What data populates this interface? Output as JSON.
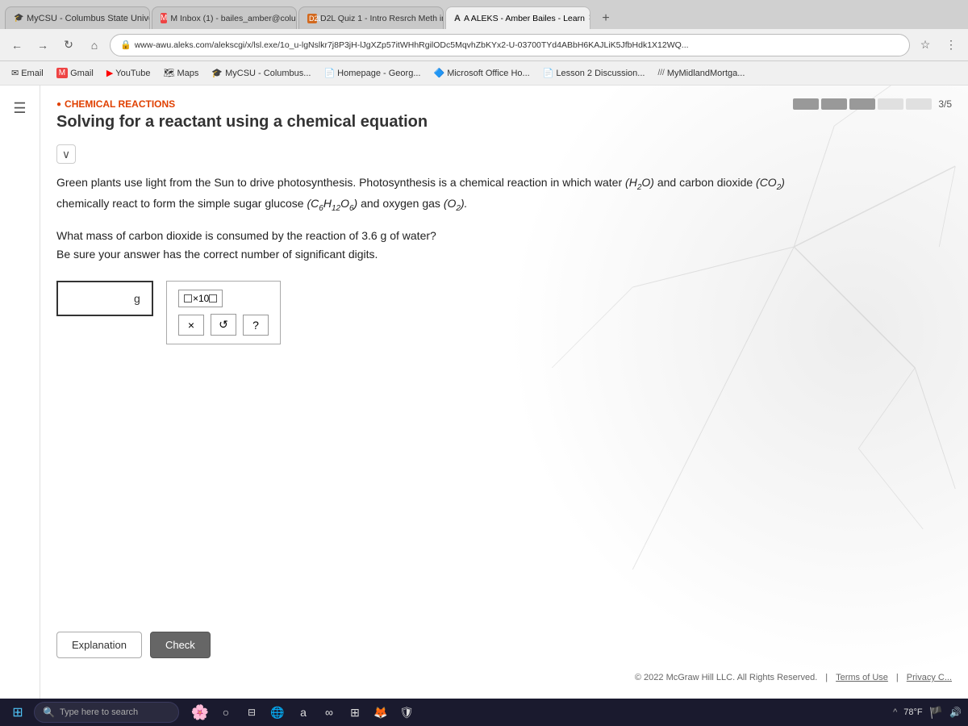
{
  "browser": {
    "tabs": [
      {
        "id": "tab1",
        "label": "MyCSU - Columbus State Univers",
        "active": false,
        "favicon": "🎓"
      },
      {
        "id": "tab2",
        "label": "M Inbox (1) - bailes_amber@colum",
        "active": false,
        "favicon": "M"
      },
      {
        "id": "tab3",
        "label": "D2L Quiz 1 - Intro Resrch Meth in Cl",
        "active": false,
        "favicon": "D2L"
      },
      {
        "id": "tab4",
        "label": "A ALEKS - Amber Bailes - Learn",
        "active": true,
        "favicon": "A"
      }
    ],
    "url": "www-awu.aleks.com/alekscgi/x/lsl.exe/1o_u-lgNslkr7j8P3jH-lJgXZp57itWHhRgilODc5MqvhZbKYx2-U-03700TYd4ABbH6KAJLiK5JfbHdk1X12WQ...",
    "bookmarks": [
      {
        "label": "Email",
        "icon": "✉"
      },
      {
        "label": "Gmail",
        "icon": "M"
      },
      {
        "label": "YouTube",
        "icon": "▶"
      },
      {
        "label": "Maps",
        "icon": "📍"
      },
      {
        "label": "MyCSU - Columbus...",
        "icon": "🎓"
      },
      {
        "label": "Homepage - Georg...",
        "icon": "📄"
      },
      {
        "label": "Microsoft Office Ho...",
        "icon": "🔷"
      },
      {
        "label": "Lesson 2 Discussion...",
        "icon": "📄"
      },
      {
        "label": "MyMidlandMortga...",
        "icon": "///"
      }
    ]
  },
  "aleks": {
    "section": "CHEMICAL REACTIONS",
    "title": "Solving for a reactant using a chemical equation",
    "progress": {
      "current": 3,
      "total": 5,
      "label": "3/5",
      "segments": 5
    },
    "problem_text_line1": "Green plants use light from the Sun to drive photosynthesis. Photosynthesis is a chemical reaction in which water",
    "water_formula": "(H₂O)",
    "and_text": "and carbon dioxide",
    "co2_formula": "(CO₂)",
    "problem_text_line2": "chemically react to form the simple sugar glucose",
    "glucose_formula": "(C₆H₁₂O₆)",
    "and_oxygen": "and oxygen gas",
    "oxygen_formula": "(O₂).",
    "question_line1": "What mass of carbon dioxide is consumed by the reaction of 3.6 g of water?",
    "question_line2": "Be sure your answer has the correct number of significant digits.",
    "answer_unit": "g",
    "math_buttons": {
      "fraction_label": "□/□",
      "x10_label": "□×10□",
      "times_label": "×",
      "undo_label": "↺",
      "help_label": "?"
    },
    "buttons": {
      "explanation": "Explanation",
      "check": "Check"
    },
    "footer": {
      "copyright": "© 2022 McGraw Hill LLC. All Rights Reserved.",
      "terms": "Terms of Use",
      "privacy": "Privacy C..."
    }
  },
  "taskbar": {
    "search_placeholder": "Type here to search",
    "temperature": "78°F",
    "time": "^"
  }
}
